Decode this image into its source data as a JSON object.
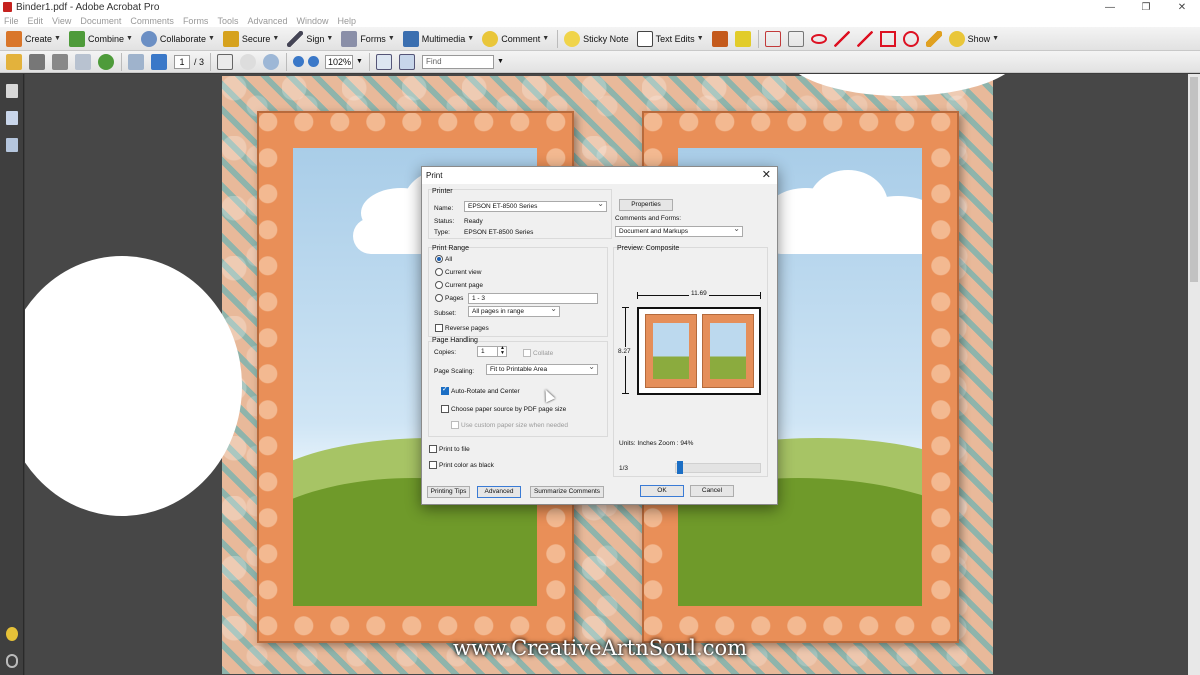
{
  "window": {
    "title": "Binder1.pdf - Adobe Acrobat Pro"
  },
  "menu": [
    "File",
    "Edit",
    "View",
    "Document",
    "Comments",
    "Forms",
    "Tools",
    "Advanced",
    "Window",
    "Help"
  ],
  "toolbar1": {
    "create": "Create",
    "combine": "Combine",
    "collaborate": "Collaborate",
    "secure": "Secure",
    "sign": "Sign",
    "forms": "Forms",
    "multimedia": "Multimedia",
    "comment": "Comment",
    "sticky_note": "Sticky Note",
    "text_edits": "Text Edits",
    "show": "Show"
  },
  "toolbar2": {
    "page_current": "1",
    "page_total": "/ 3",
    "zoom": "102%",
    "find_placeholder": "Find"
  },
  "watermark": "www.CreativeArtnSoul.com",
  "dialog": {
    "title": "Print",
    "close": "✕",
    "printer_group": "Printer",
    "name_label": "Name:",
    "printer_name": "EPSON ET-8500 Series",
    "properties": "Properties",
    "status_label": "Status:",
    "status_value": "Ready",
    "type_label": "Type:",
    "type_value": "EPSON ET-8500 Series",
    "comments_forms_label": "Comments and Forms:",
    "comments_forms_value": "Document and Markups",
    "print_range_group": "Print Range",
    "range_all": "All",
    "range_current_view": "Current view",
    "range_current_page": "Current page",
    "range_pages": "Pages",
    "pages_value": "1 - 3",
    "subset_label": "Subset:",
    "subset_value": "All pages in range",
    "reverse_pages": "Reverse pages",
    "page_handling_group": "Page Handling",
    "copies_label": "Copies:",
    "copies_value": "1",
    "collate": "Collate",
    "page_scaling_label": "Page Scaling:",
    "page_scaling_value": "Fit to Printable Area",
    "auto_rotate": "Auto-Rotate and Center",
    "choose_paper": "Choose paper source by PDF page size",
    "custom_paper": "Use custom paper size when needed",
    "print_to_file": "Print to file",
    "print_color_black": "Print color as black",
    "preview_label": "Preview: Composite",
    "width_dim": "11.69",
    "height_dim": "8.27",
    "units_zoom": "Units: Inches Zoom :  94%",
    "page_indicator": "1/3",
    "printing_tips": "Printing Tips",
    "advanced": "Advanced",
    "summarize_comments": "Summarize Comments",
    "ok": "OK",
    "cancel": "Cancel"
  }
}
